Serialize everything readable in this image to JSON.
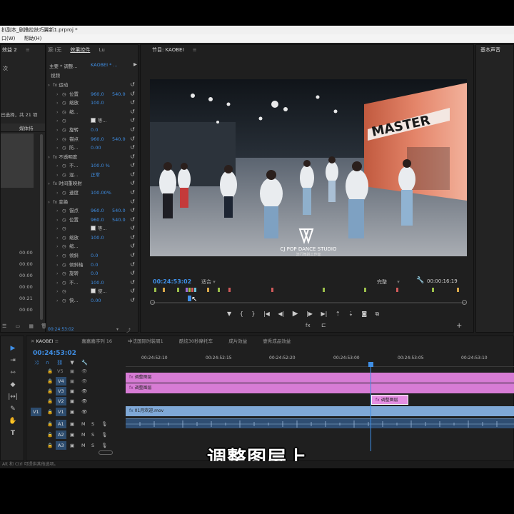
{
  "window": {
    "title": "扒副本_剧撸拉扶巧翼新1.prproj *",
    "menus": [
      "口(W)",
      "帮助(H)"
    ]
  },
  "left_panel": {
    "tab": "效益 2",
    "label_a": "次",
    "filter_text": "已选择，共 21 项",
    "col_header": "媒体持",
    "timecodes": [
      "00:00",
      "00:00",
      "00:00",
      "00:00",
      "00:21",
      "00:00"
    ]
  },
  "effect_controls": {
    "tabs": [
      "源:(无",
      "效果控件",
      "Lu"
    ],
    "source_label": "主要 * 调整...",
    "clip_label": "KAOBEI * ...",
    "section_video": "视频",
    "groups": [
      {
        "name": "运动",
        "props": [
          {
            "name": "位置",
            "v1": "960.0",
            "v2": "540.0"
          },
          {
            "name": "缩放",
            "v1": "100.0",
            "v2": ""
          },
          {
            "name": "缩...",
            "v1": "",
            "v2": ""
          },
          {
            "name": "等...",
            "v1": "",
            "v2": "",
            "checkbox": true
          },
          {
            "name": "旋转",
            "v1": "0.0",
            "v2": ""
          },
          {
            "name": "锚点",
            "v1": "960.0",
            "v2": "540.0"
          },
          {
            "name": "防...",
            "v1": "0.00",
            "v2": ""
          }
        ]
      },
      {
        "name": "不透明度",
        "props": [
          {
            "name": "不...",
            "v1": "100.0 %",
            "v2": ""
          },
          {
            "name": "混...",
            "v1": "正常",
            "v2": ""
          }
        ]
      },
      {
        "name": "时间重映射",
        "props": [
          {
            "name": "速度",
            "v1": "100.00%",
            "v2": ""
          }
        ]
      },
      {
        "name": "变换",
        "props": [
          {
            "name": "锚点",
            "v1": "960.0",
            "v2": "540.0"
          },
          {
            "name": "位置",
            "v1": "960.0",
            "v2": "540.0"
          },
          {
            "name": "等...",
            "v1": "",
            "v2": "",
            "checkbox": true
          },
          {
            "name": "缩放",
            "v1": "100.0",
            "v2": ""
          },
          {
            "name": "缩...",
            "v1": "",
            "v2": ""
          },
          {
            "name": "倾斜",
            "v1": "0.0",
            "v2": ""
          },
          {
            "name": "倾斜轴",
            "v1": "0.0",
            "v2": ""
          },
          {
            "name": "旋转",
            "v1": "0.0",
            "v2": ""
          },
          {
            "name": "不...",
            "v1": "100.0",
            "v2": ""
          },
          {
            "name": "使...",
            "v1": "",
            "v2": "",
            "checkbox": true
          },
          {
            "name": "快...",
            "v1": "0.00",
            "v2": ""
          }
        ]
      }
    ],
    "footer_timecode": "00:24:53:02"
  },
  "program_monitor": {
    "title": "节目: KAOBEI",
    "timecode": "00:24:53:02",
    "fit": "适合",
    "quality": "完整",
    "duration": "00:00:16:19",
    "watermark_line1": "CJ POP DANCE STUDIO",
    "watermark_line2": "流行舞蹈工作室",
    "banner_text": "MASTER"
  },
  "right_panel": {
    "title": "基本声音"
  },
  "timeline": {
    "sequence_tab": "KAOBEI",
    "other_tabs": [
      "嘉嘉嘉序列 16",
      "中法国际时装周1",
      "酷炫30秒摩托车",
      "成片效益",
      "壹秀成品效益"
    ],
    "timecode": "00:24:53:02",
    "ruler": [
      "00:24:52:10",
      "00:24:52:15",
      "00:24:52:20",
      "00:24:53:00",
      "00:24:53:05",
      "00:24:53:10"
    ],
    "tracks": [
      "V3",
      "V2",
      "V1",
      "A1",
      "A2",
      "A3"
    ],
    "clip_adjust_1": "调整图层",
    "clip_adjust_2": "调整图层",
    "clip_adjust_3": "调整图层",
    "clip_video": "01月欢迎.mov",
    "extra_tracks": [
      "V5",
      "V4"
    ]
  },
  "status_bar": "Alt 和 Ctrl 可提供其他选项。",
  "subtitle": "调整图层上",
  "colors": {
    "accent_blue": "#3f8fe6",
    "adjust_clip": "#d77cd5",
    "video_clip": "#7fa8d6",
    "audio_clip": "#2f4e73",
    "playhead": "#3f8fe6"
  }
}
